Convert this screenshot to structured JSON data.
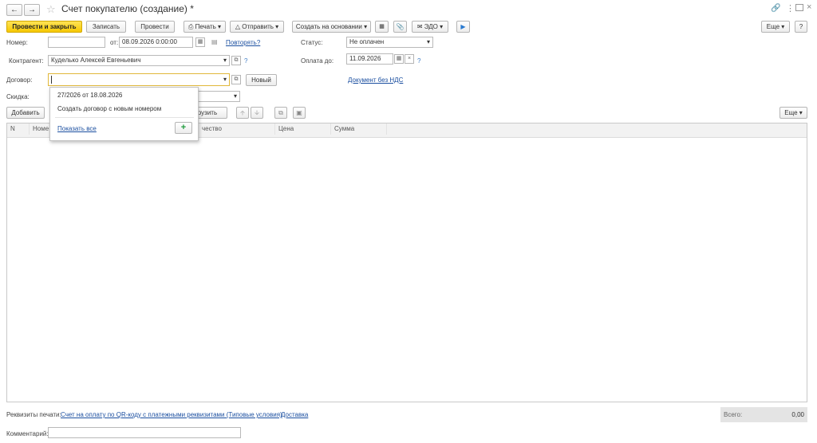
{
  "title_bar": {
    "title": "Счет покупателю (создание) *",
    "back_icon": "arrow-left-icon",
    "forward_icon": "arrow-right-icon",
    "favorite_icon": "star-icon",
    "link_icon": "link-icon",
    "more_icon": "kebab-menu-icon",
    "restore_icon": "window-restore-icon",
    "close_icon": "close-icon"
  },
  "toolbar": {
    "post_and_close": "Провести и закрыть",
    "save": "Записать",
    "post": "Провести",
    "print": "Печать",
    "send": "Отправить",
    "create_based_on": "Создать на основании",
    "edo": "ЭДО",
    "more": "Еще",
    "help": "?"
  },
  "form": {
    "number_label": "Номер:",
    "number_value": "",
    "date_label": "от:",
    "date_value": "08.09.2026  0:00:00",
    "repeat_link": "Повторять?",
    "status_label": "Статус:",
    "status_value": "Не оплачен",
    "counterparty_label": "Контрагент:",
    "counterparty_value": "Кудeлько Алексей Евгеньевич",
    "pay_by_label": "Оплата до:",
    "pay_by_value": "11.09.2026",
    "contract_label": "Договор:",
    "contract_value": "",
    "new_button": "Новый",
    "no_vat_link": "Документ без НДС",
    "discount_label": "Скидка:",
    "help_mark": "?"
  },
  "dropdown": {
    "item_contract": "27/2026 от 18.08.2026",
    "item_create": "Создать договор с новым номером",
    "show_all": "Показать все",
    "add": "+"
  },
  "table_toolbar": {
    "add": "Добавить",
    "fill": "грузить",
    "more": "Еще"
  },
  "table": {
    "columns": [
      "N",
      "Номе",
      "",
      "чество",
      "Цена",
      "Сумма"
    ],
    "rows": []
  },
  "footer": {
    "print_details_label": "Реквизиты печати:",
    "print_details_link": "Счет на оплату по QR-коду с платежными реквизитами (Типовые условия)",
    "delivery_link": "Доставка",
    "total_label": "Всего:",
    "total_value": "0,00",
    "comment_label": "Комментарий:",
    "comment_value": ""
  }
}
